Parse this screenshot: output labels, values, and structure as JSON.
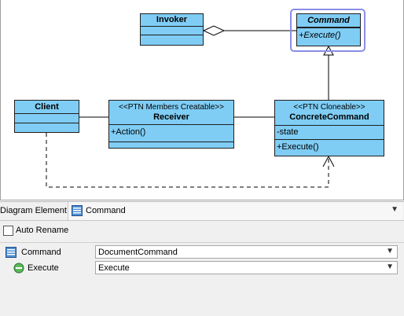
{
  "diagram": {
    "classes": {
      "invoker": {
        "name": "Invoker"
      },
      "command": {
        "name": "Command",
        "operations": [
          "+Execute()"
        ]
      },
      "client": {
        "name": "Client"
      },
      "receiver": {
        "stereotype": "<<PTN Members Creatable>>",
        "name": "Receiver",
        "operations": [
          "+Action()"
        ]
      },
      "concrete": {
        "stereotype": "<<PTN Cloneable>>",
        "name": "ConcreteCommand",
        "attributes": [
          "-state"
        ],
        "operations": [
          "+Execute()"
        ]
      }
    },
    "selected": "Command"
  },
  "panel": {
    "label": "Diagram Element",
    "combo": {
      "value": "Command",
      "icon": "class-icon"
    },
    "auto_rename": {
      "label": "Auto Rename",
      "checked": false
    },
    "properties": [
      {
        "name": "Command",
        "icon": "class-icon",
        "value": "DocumentCommand"
      },
      {
        "name": "Execute",
        "icon": "operation-icon",
        "value": "Execute"
      }
    ]
  },
  "colors": {
    "class_fill": "#7fcdf5",
    "selection": "#8a8ee6",
    "panel_bg": "#f0f0f0"
  }
}
